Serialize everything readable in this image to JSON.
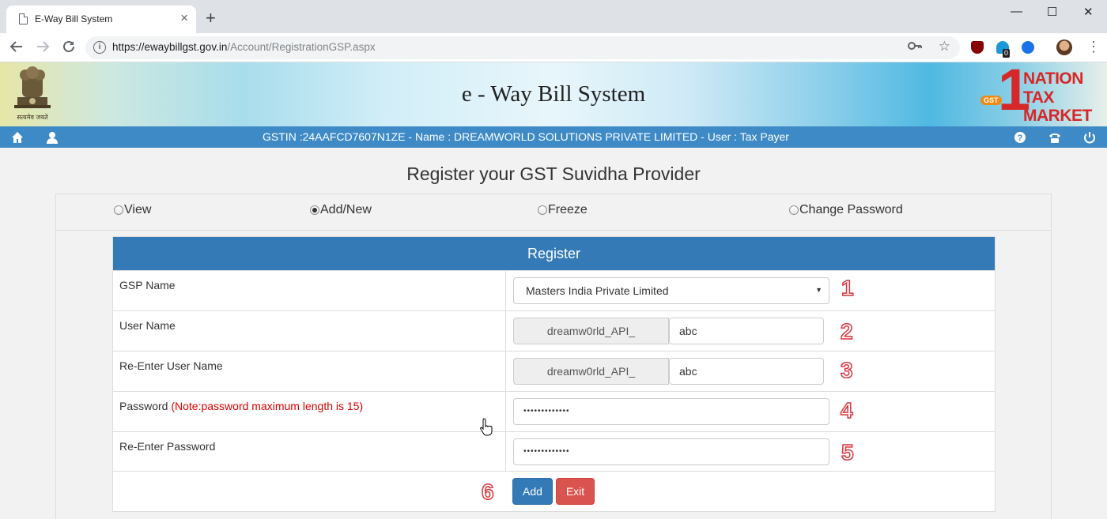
{
  "browser": {
    "tab_title": "E-Way Bill System",
    "tab_close": "×",
    "new_tab": "+",
    "url_host": "https://ewaybillgst.gov.in",
    "url_path": "/Account/RegistrationGSP.aspx",
    "extension_badge": "0",
    "icons": [
      "back-icon",
      "forward-icon",
      "reload-icon",
      "info-icon",
      "key-icon",
      "star-icon",
      "ublock-icon",
      "extension-icon",
      "sync-icon",
      "profile-avatar",
      "menu-icon"
    ]
  },
  "window_controls": {
    "minimize": "—",
    "maximize": "☐",
    "close": "✕"
  },
  "header": {
    "site_title": "e - Way Bill System",
    "emblem_caption": "सत्यमेव जयते",
    "logo_text": {
      "number": "1",
      "line1": "NATION",
      "line2": "TAX",
      "line3": "MARKET",
      "gst": "GST"
    }
  },
  "infobar": {
    "text": "GSTIN :24AAFCD7607N1ZE - Name : DREAMWORLD SOLUTIONS PRIVATE LIMITED - User : Tax Payer",
    "icons": [
      "home-icon",
      "user-icon",
      "help-icon",
      "phone-icon",
      "power-icon"
    ]
  },
  "page": {
    "heading": "Register your GST Suvidha Provider",
    "options": [
      {
        "label": "View",
        "selected": false
      },
      {
        "label": "Add/New",
        "selected": true
      },
      {
        "label": "Freeze",
        "selected": false
      },
      {
        "label": "Change Password",
        "selected": false
      }
    ]
  },
  "form": {
    "title": "Register",
    "gsp_label": "GSP Name",
    "gsp_value": "Masters India Private Limited",
    "username_label": "User Name",
    "username_prefix": "dreamw0rld_API_",
    "username_value": "abc",
    "reusername_label": "Re-Enter User Name",
    "reusername_prefix": "dreamw0rld_API_",
    "reusername_value": "abc",
    "password_label": "Password",
    "password_note": "(Note:password maximum length is 15)",
    "password_value": "•••••••••••••",
    "repassword_label": "Re-Enter Password",
    "repassword_value": "•••••••••••••",
    "add_label": "Add",
    "exit_label": "Exit"
  },
  "annotations": [
    "1",
    "2",
    "3",
    "4",
    "5",
    "6"
  ],
  "colors": {
    "primary": "#337ab7",
    "danger": "#d9534f",
    "infobar": "#3d8ac7",
    "annotation": "#d9363e",
    "note": "#e00000"
  }
}
